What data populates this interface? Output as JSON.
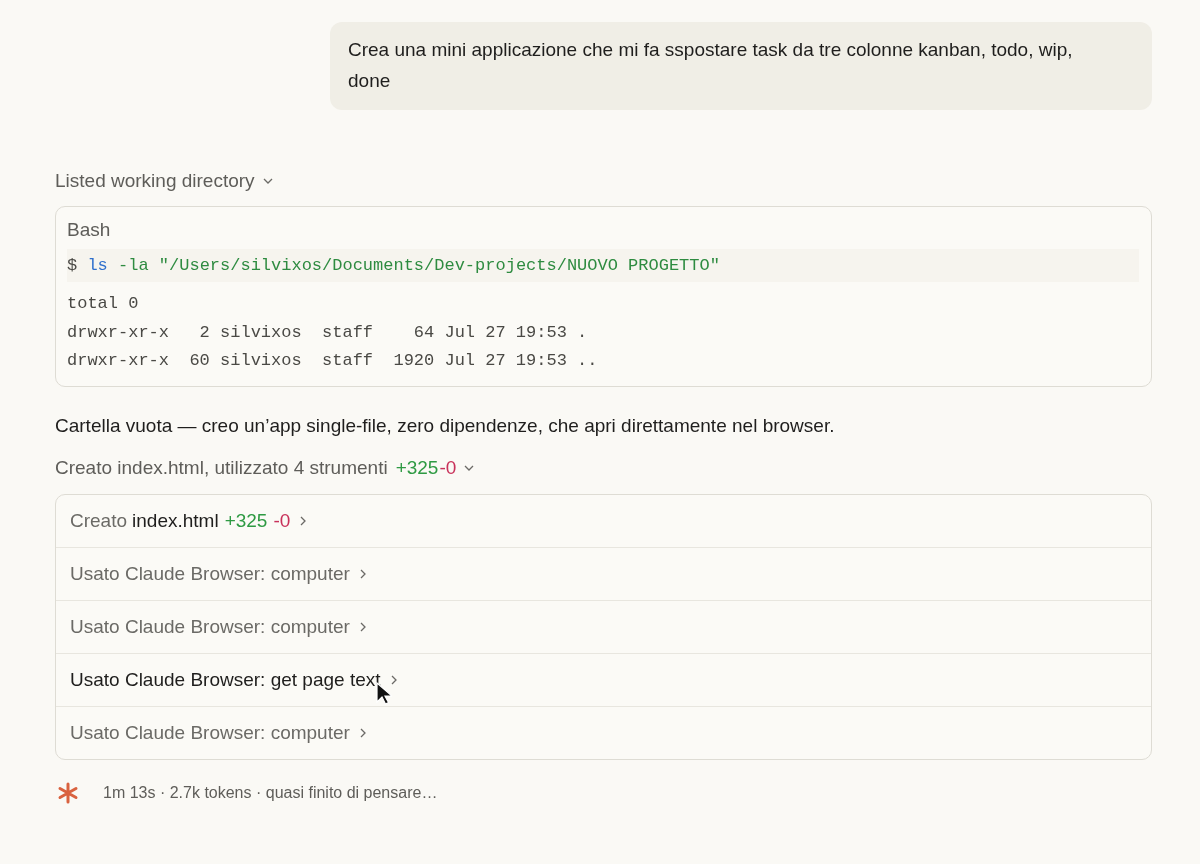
{
  "user_message": {
    "text": "Crea una mini applicazione che mi fa sspostare task da tre colonne kanban, todo, wip, done"
  },
  "step_1": {
    "summary": "Listed working directory",
    "expanded": true,
    "shell": "Bash",
    "command": {
      "prompt": "$",
      "program": "ls",
      "args": "-la \"/Users/silvixos/Documents/Dev-projects/NUOVO PROGETTO\""
    },
    "output": [
      "total 0",
      "drwxr-xr-x   2 silvixos  staff    64 Jul 27 19:53 .",
      "drwxr-xr-x  60 silvixos  staff  1920 Jul 27 19:53 .."
    ]
  },
  "assistant_text": "Cartella vuota — creo un’app single-file, zero dipendenze, che apri direttamente nel browser.",
  "step_2": {
    "summary": "Creato index.html, utilizzato 4 strumenti",
    "added": "+325",
    "removed": "-0",
    "expanded": true,
    "items": [
      {
        "kind": "file",
        "verb": "Creato",
        "file": "index.html",
        "added": "+325",
        "removed": "-0",
        "hovered": false
      },
      {
        "kind": "tool",
        "label": "Usato Claude Browser: computer",
        "hovered": false
      },
      {
        "kind": "tool",
        "label": "Usato Claude Browser: computer",
        "hovered": false
      },
      {
        "kind": "tool",
        "label": "Usato Claude Browser: get page text",
        "hovered": true
      },
      {
        "kind": "tool",
        "label": "Usato Claude Browser: computer",
        "hovered": false
      }
    ]
  },
  "status": {
    "text": "1m 13s · 2.7k tokens · quasi finito di pensare…"
  }
}
